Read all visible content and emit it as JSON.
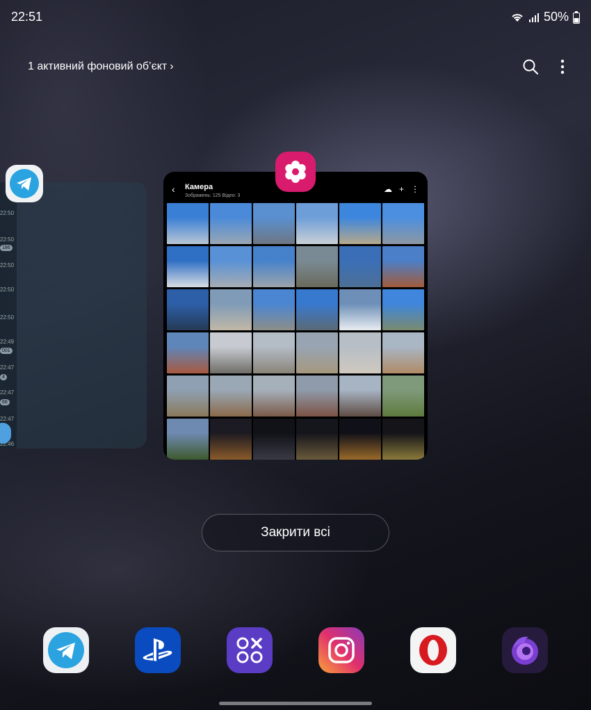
{
  "status_bar": {
    "time": "22:51",
    "battery": "50%"
  },
  "recents": {
    "background_label": "1 активний фоновий об’єкт",
    "chevron": "›"
  },
  "side_card": {
    "app_icon": "telegram-icon",
    "entries": [
      "22:50",
      "22:50",
      "186",
      "22:50",
      "22:50",
      "22:50",
      "22:49",
      "001",
      "22:47",
      "4",
      "22:47",
      "66",
      "22:47",
      "22:46"
    ]
  },
  "main_card": {
    "app_icon": "gallery-flower-icon",
    "app_icon_color": "#d91b6e",
    "gallery": {
      "title": "Камера",
      "subtitle": "Зображень: 125 Відео: 3",
      "thumbnails": 36
    }
  },
  "close_all_label": "Закрити всі",
  "dock": [
    {
      "name": "telegram",
      "icon": "telegram-icon",
      "color": "#2aa3e0"
    },
    {
      "name": "playstation",
      "icon": "playstation-icon",
      "color": "#0a4bbf"
    },
    {
      "name": "good-lock",
      "icon": "good-lock-icon",
      "color": "#5b3cc4"
    },
    {
      "name": "instagram",
      "icon": "instagram-icon",
      "color": "#e1306c"
    },
    {
      "name": "opera",
      "icon": "opera-icon",
      "color": "#d71920"
    },
    {
      "name": "firefox",
      "icon": "firefox-icon",
      "color": "#8a3cd6"
    }
  ]
}
